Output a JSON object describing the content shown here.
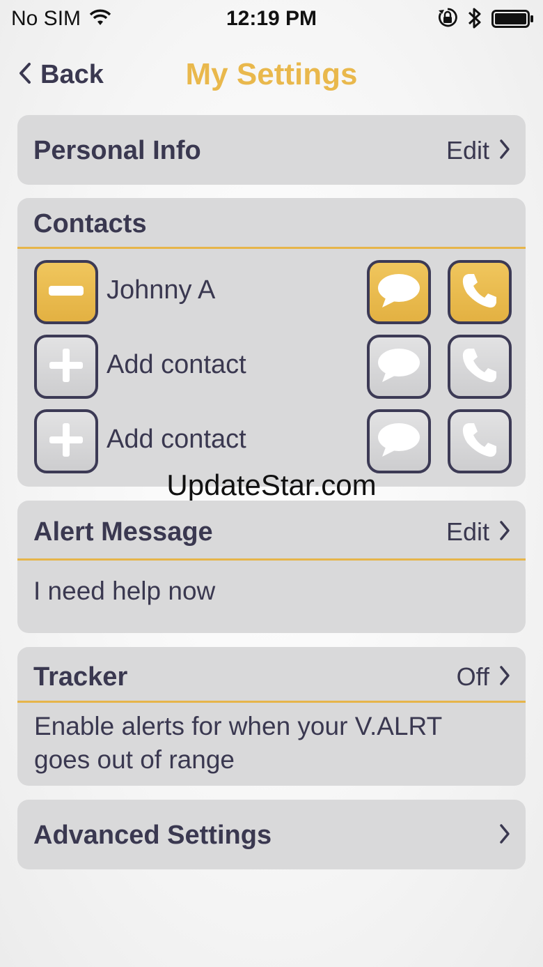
{
  "status_bar": {
    "carrier": "No SIM",
    "time": "12:19 PM",
    "icons": [
      "wifi-icon",
      "orientation-lock-icon",
      "bluetooth-icon",
      "battery-icon"
    ]
  },
  "nav": {
    "back_label": "Back",
    "title": "My Settings"
  },
  "personal_info": {
    "title": "Personal Info",
    "action": "Edit"
  },
  "contacts": {
    "title": "Contacts",
    "rows": [
      {
        "name": "Johnny A",
        "state": "active"
      },
      {
        "name": "Add contact",
        "state": "empty"
      },
      {
        "name": "Add contact",
        "state": "empty"
      }
    ]
  },
  "alert_message": {
    "title": "Alert Message",
    "action": "Edit",
    "message": "I need help now"
  },
  "tracker": {
    "title": "Tracker",
    "action": "Off",
    "description_line1": "Enable alerts for when your V.ALRT",
    "description_line2": "goes out of range"
  },
  "advanced": {
    "title": "Advanced Settings"
  },
  "watermark": "UpdateStar.com",
  "colors": {
    "accent": "#e9b84c",
    "text": "#3a3850",
    "card": "#d9d9da"
  }
}
